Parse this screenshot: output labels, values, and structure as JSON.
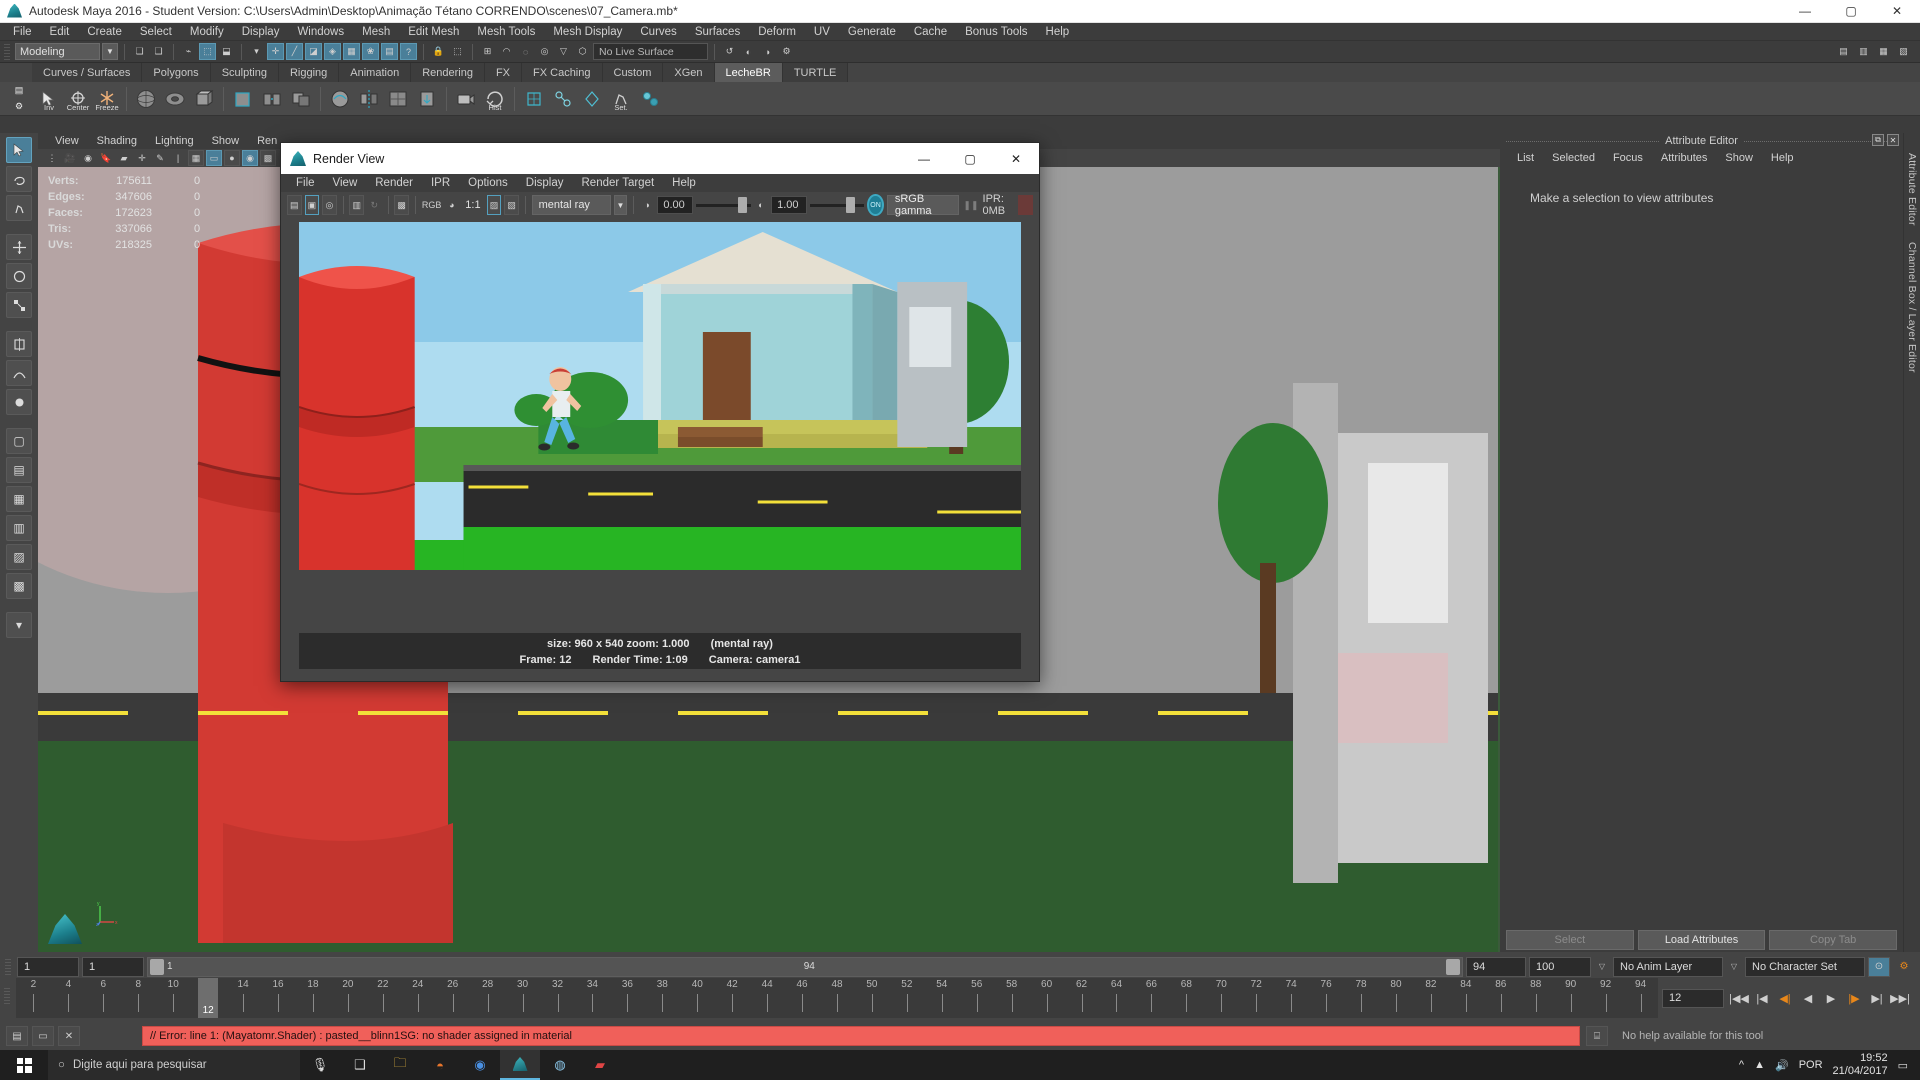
{
  "window": {
    "title": "Autodesk Maya 2016 - Student Version: C:\\Users\\Admin\\Desktop\\Animação Tétano CORRENDO\\scenes\\07_Camera.mb*",
    "minimize": "—",
    "maximize": "▢",
    "close": "✕"
  },
  "main_menu": [
    "File",
    "Edit",
    "Create",
    "Select",
    "Modify",
    "Display",
    "Windows",
    "Mesh",
    "Edit Mesh",
    "Mesh Tools",
    "Mesh Display",
    "Curves",
    "Surfaces",
    "Deform",
    "UV",
    "Generate",
    "Cache",
    "Bonus Tools",
    "Help"
  ],
  "status_line": {
    "menu_set": "Modeling",
    "live_surface": "No Live Surface",
    "dropdown_arrow": "▼"
  },
  "shelf": {
    "tabs": [
      "Curves / Surfaces",
      "Polygons",
      "Sculpting",
      "Rigging",
      "Animation",
      "Rendering",
      "FX",
      "FX Caching",
      "Custom",
      "XGen",
      "LecheBR",
      "TURTLE"
    ],
    "active_tab": "LecheBR",
    "button_labels": [
      "Inv",
      "Center",
      "Freeze",
      "Hist",
      "Set."
    ]
  },
  "viewport": {
    "menu": [
      "View",
      "Shading",
      "Lighting",
      "Show",
      "Ren"
    ],
    "hud": {
      "rows": [
        {
          "label": "Verts:",
          "value": "175611",
          "selected": "0"
        },
        {
          "label": "Edges:",
          "value": "347606",
          "selected": "0"
        },
        {
          "label": "Faces:",
          "value": "172623",
          "selected": "0"
        },
        {
          "label": "Tris:",
          "value": "337066",
          "selected": "0"
        },
        {
          "label": "UVs:",
          "value": "218325",
          "selected": "0"
        }
      ]
    },
    "axis_labels": {
      "y": "y",
      "x": "x",
      "z": "z"
    }
  },
  "attribute_editor": {
    "title": "Attribute Editor",
    "menu": [
      "List",
      "Selected",
      "Focus",
      "Attributes",
      "Show",
      "Help"
    ],
    "empty_message": "Make a selection to view attributes",
    "buttons": [
      "Select",
      "Load Attributes",
      "Copy Tab"
    ],
    "vertical_tabs": [
      "Attribute Editor",
      "Channel Box / Layer Editor"
    ],
    "float_icon": "⧉",
    "close_icon": "✕"
  },
  "render_view": {
    "title": "Render View",
    "minimize": "—",
    "maximize": "▢",
    "close": "✕",
    "menu": [
      "File",
      "View",
      "Render",
      "IPR",
      "Options",
      "Display",
      "Render Target",
      "Help"
    ],
    "toolbar": {
      "renderer": "mental ray",
      "dropdown_arrow": "▼",
      "ratio_label": "1:1",
      "rgb_label": "RGB",
      "exposure_value": "0.00",
      "gamma_value": "1.00",
      "color_management": "sRGB gamma",
      "gamma_toggle": "ON",
      "ipr_label": "IPR: 0MB"
    },
    "status": {
      "size": "size: 960 x 540 zoom: 1.000",
      "renderer": "(mental ray)",
      "frame": "Frame: 12",
      "render_time": "Render Time:  1:09",
      "camera": "Camera: camera1"
    }
  },
  "time_slider": {
    "start_field": "1",
    "start_field2": "1",
    "range_left_value": "1",
    "range_right_value": "94",
    "anim_start": "94",
    "anim_end": "100",
    "anim_layer": "No Anim Layer",
    "character_set": "No Character Set",
    "current_frame": "12",
    "current_frame_field": "12",
    "ticks": [
      "2",
      "4",
      "6",
      "8",
      "10",
      "12",
      "14",
      "16",
      "18",
      "20",
      "22",
      "24",
      "26",
      "28",
      "30",
      "32",
      "34",
      "36",
      "38",
      "40",
      "42",
      "44",
      "46",
      "48",
      "50",
      "52",
      "54",
      "56",
      "58",
      "60",
      "62",
      "64",
      "66",
      "68",
      "70",
      "72",
      "74",
      "76",
      "78",
      "80",
      "82",
      "84",
      "86",
      "88",
      "90",
      "92",
      "94"
    ],
    "playback_buttons": [
      "|◀◀",
      "|◀",
      "◀|",
      "◀",
      "▶",
      "|▶",
      "▶|",
      "▶▶|"
    ]
  },
  "command_line": {
    "error_message": "// Error: line 1: (Mayatomr.Shader) : pasted__blinn1SG: no shader assigned in material",
    "help_text": "No help available for this tool",
    "script_editor_icon": "⌸"
  },
  "taskbar": {
    "search_placeholder": "Digite aqui para pesquisar",
    "language": "POR",
    "time": "19:52",
    "date": "21/04/2017",
    "show_hidden_icon": "^"
  },
  "colors": {
    "accent_blue": "#4a7f99",
    "error_red": "#f0605a",
    "maya_bg": "#3c3c3c",
    "key_orange": "#e8871a"
  }
}
